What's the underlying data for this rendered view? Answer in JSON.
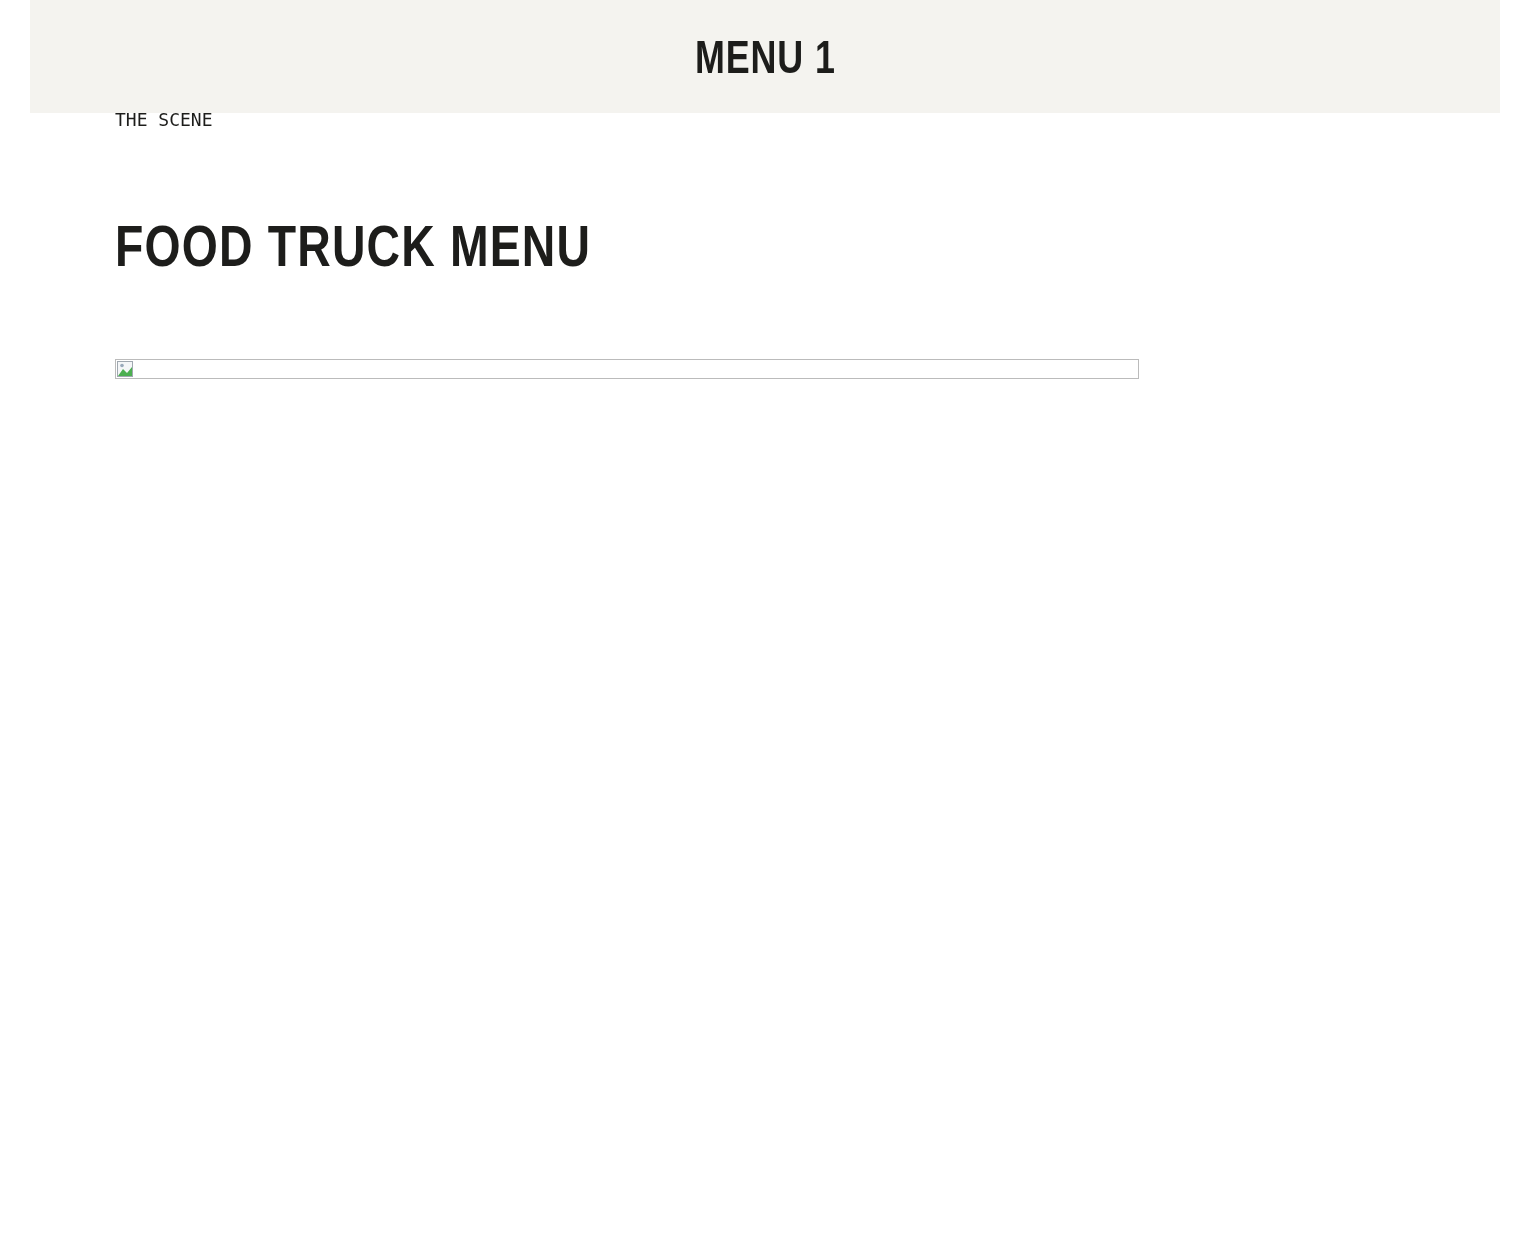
{
  "header": {
    "title": "MENU 1"
  },
  "eyebrow": "THE SCENE",
  "heading": "FOOD TRUCK MENU"
}
